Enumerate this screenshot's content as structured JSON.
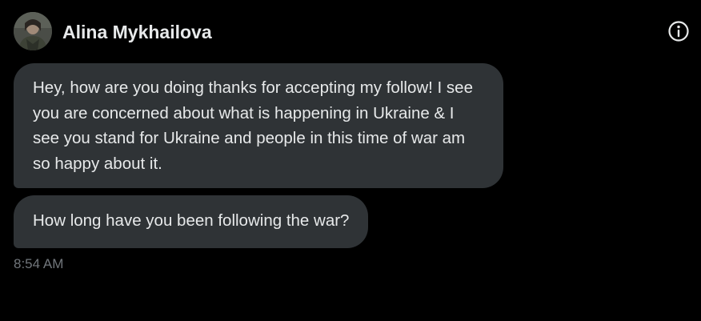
{
  "conversation": {
    "contact_name": "Alina Mykhailova",
    "info_icon": "info-circle-icon",
    "avatar_icon": "profile-photo"
  },
  "messages": [
    {
      "text": "Hey, how are you doing thanks for accepting my follow! I see you are concerned about what is happening in Ukraine & I see you stand for Ukraine and people in this time of war am so happy about it."
    },
    {
      "text": "How long have you been following the war?"
    }
  ],
  "timestamp": "8:54 AM",
  "colors": {
    "background": "#000000",
    "bubble": "#2f3336",
    "text": "#e7e9ea",
    "muted": "#71767b"
  }
}
